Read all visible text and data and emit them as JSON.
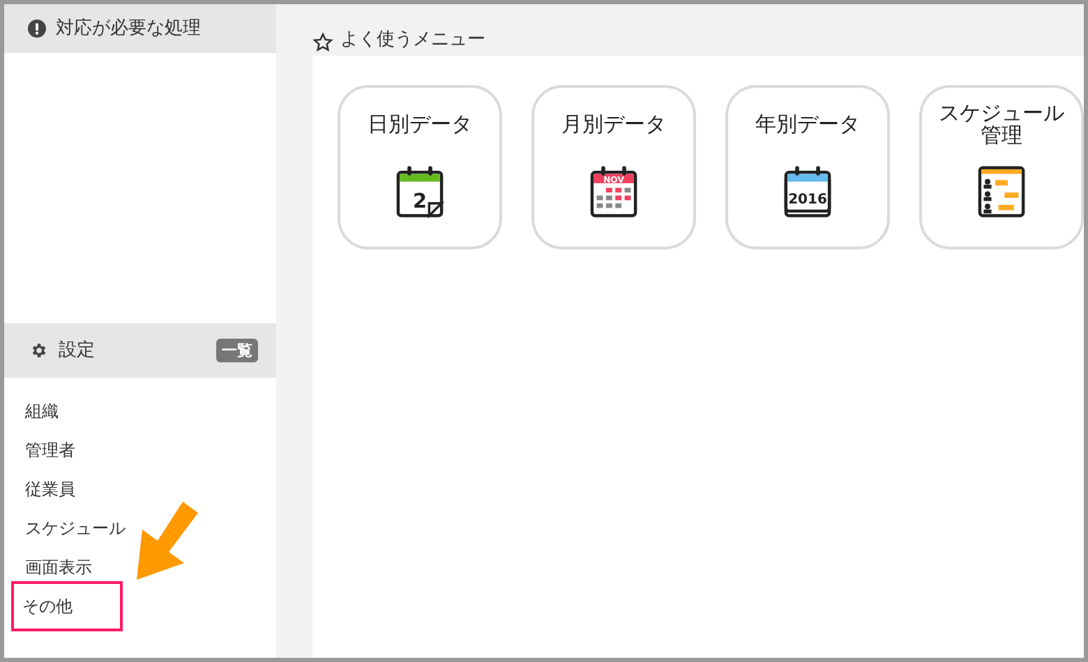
{
  "alerts": {
    "title": "対応が必要な処理"
  },
  "favorites": {
    "title": "よく使うメニュー",
    "items": [
      {
        "label": "日別データ",
        "kind": "day",
        "icon_text": "2"
      },
      {
        "label": "月別データ",
        "kind": "month",
        "icon_text": "NOV"
      },
      {
        "label": "年別データ",
        "kind": "year",
        "icon_text": "2016"
      },
      {
        "label": "スケジュール管理",
        "kind": "schedule"
      }
    ]
  },
  "settings": {
    "title": "設定",
    "list_button": "一覧",
    "items": [
      {
        "label": "組織",
        "highlighted": false
      },
      {
        "label": "管理者",
        "highlighted": false
      },
      {
        "label": "従業員",
        "highlighted": false
      },
      {
        "label": "スケジュール",
        "highlighted": false
      },
      {
        "label": "画面表示",
        "highlighted": false
      },
      {
        "label": "その他",
        "highlighted": true
      }
    ]
  }
}
